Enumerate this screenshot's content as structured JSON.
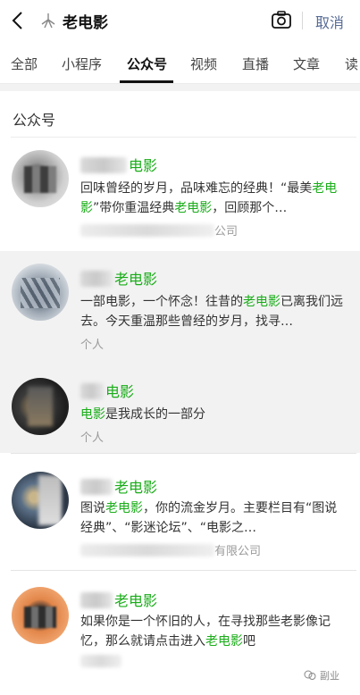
{
  "header": {
    "query": "老电影",
    "cancel_label": "取消"
  },
  "tabs": [
    {
      "label": "全部"
    },
    {
      "label": "小程序"
    },
    {
      "label": "公众号"
    },
    {
      "label": "视频"
    },
    {
      "label": "直播"
    },
    {
      "label": "文章"
    },
    {
      "label": "读"
    }
  ],
  "active_tab": "公众号",
  "section": {
    "title": "公众号"
  },
  "results": [
    {
      "name": "电影",
      "desc_parts": [
        "回味曾经的岁月，品味难忘的经典！“最美",
        "老电影",
        "”带你重温经典",
        "老电影",
        "，回顾那个…"
      ],
      "meta": "公司"
    },
    {
      "name": "老电影",
      "desc_parts": [
        "一部电影，一个怀念！往昔的",
        "老电影",
        "已离我们远去。今天重温那些曾经的岁月，找寻…"
      ],
      "meta": "个人"
    },
    {
      "name": "电影",
      "desc_parts": [
        "",
        "电影",
        "是我成长的一部分"
      ],
      "meta": "个人"
    },
    {
      "name": "老电影",
      "desc_parts": [
        "图说",
        "老电影",
        "，你的流金岁月。主要栏目有“图说经典”、“影迷论坛”、“电影之…"
      ],
      "meta": "有限公司"
    },
    {
      "name": "老电影",
      "desc_parts": [
        "如果你是一个怀旧的人，在寻找那些老影像记忆，那么就请点击进入",
        "老电影",
        "吧"
      ],
      "meta": ""
    }
  ],
  "watermark": "副业",
  "colors": {
    "highlight": "#1aad19",
    "link": "#576b95",
    "shaded_row": "#f2f2f2"
  }
}
